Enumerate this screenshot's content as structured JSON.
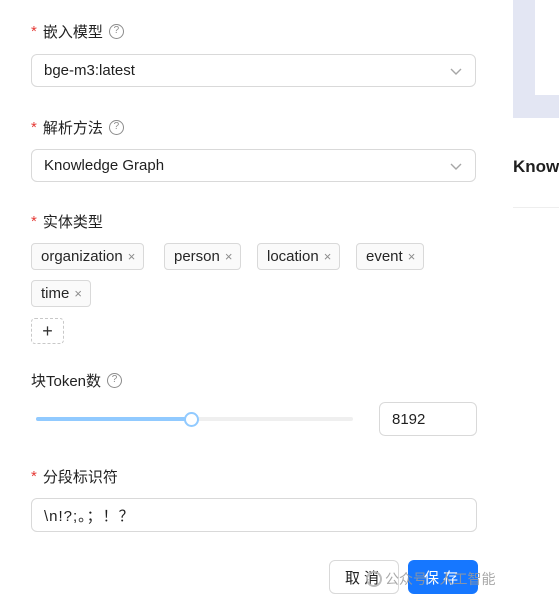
{
  "form": {
    "embedding_model": {
      "label": "嵌入模型",
      "value": "bge-m3:latest"
    },
    "parse_method": {
      "label": "解析方法",
      "value": "Knowledge Graph"
    },
    "entity_types": {
      "label": "实体类型",
      "tags": [
        "organization",
        "person",
        "location",
        "event",
        "time"
      ],
      "add_symbol": "+",
      "remove_symbol": "×"
    },
    "chunk_token": {
      "label": "块Token数",
      "value": "8192",
      "slider_fraction": 0.49
    },
    "delimiter": {
      "label": "分段标识符",
      "value": "\\n!?;。；！？"
    },
    "required_mark": "*",
    "help_mark": "?"
  },
  "footer": {
    "cancel_label": "取消",
    "save_label": "保存"
  },
  "watermark": {
    "text": "公众号 · 人工智能"
  },
  "right_pane": {
    "heading": "Know"
  },
  "colors": {
    "primary": "#1677ff",
    "required": "#e53935",
    "slider": "#91caff"
  }
}
